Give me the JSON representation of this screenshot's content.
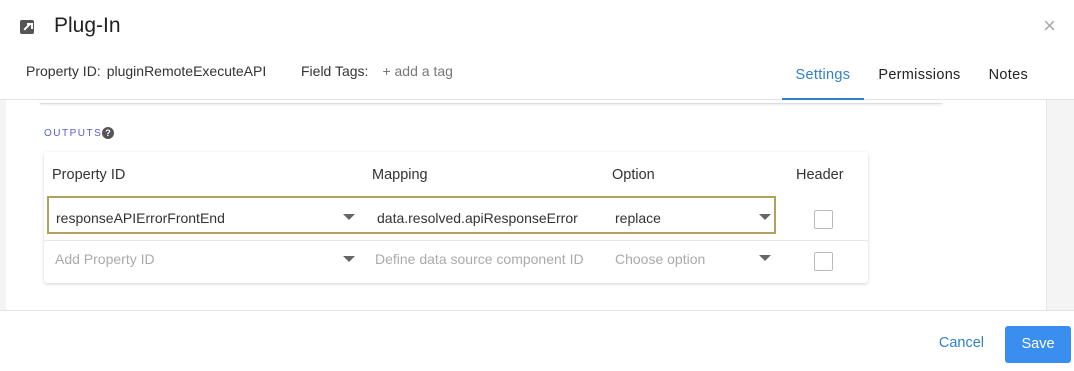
{
  "header": {
    "title": "Plug-In",
    "close_symbol": "×",
    "property_id_label": "Property ID:",
    "property_id_value": "pluginRemoteExecuteAPI",
    "field_tags_label": "Field Tags:",
    "add_tag": "+ add a tag",
    "icon": "external-link-icon"
  },
  "tabs": [
    {
      "label": "Settings",
      "active": true
    },
    {
      "label": "Permissions",
      "active": false
    },
    {
      "label": "Notes",
      "active": false
    }
  ],
  "outputs": {
    "section_label": "OUTPUTS",
    "help_symbol": "?",
    "columns": {
      "property_id": "Property ID",
      "mapping": "Mapping",
      "option": "Option",
      "header": "Header"
    },
    "rows": [
      {
        "property_id": "responseAPIErrorFrontEnd",
        "mapping": "data.resolved.apiResponseError",
        "option": "replace",
        "header": false
      }
    ],
    "new_row": {
      "property_id_placeholder": "Add Property ID",
      "mapping_placeholder": "Define data source component ID",
      "option_placeholder": "Choose option",
      "header": false
    }
  },
  "footer": {
    "cancel_label": "Cancel",
    "save_label": "Save"
  },
  "colors": {
    "accent": "#2f82c8",
    "save_button": "#3a8ef0",
    "selected_row_border": "#b3a05a",
    "outputs_label": "#5a5ad8"
  }
}
